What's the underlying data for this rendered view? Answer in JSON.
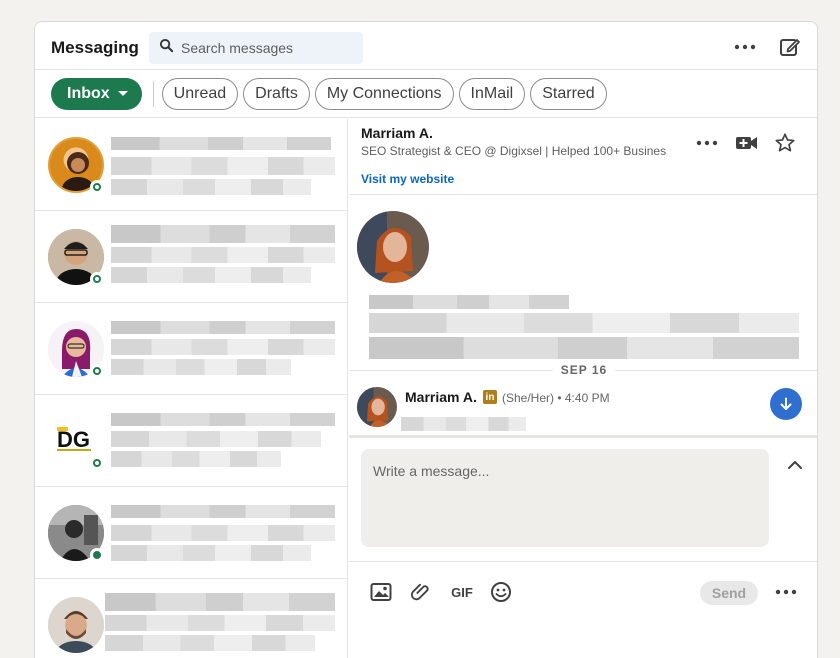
{
  "header": {
    "title": "Messaging",
    "search_placeholder": "Search messages"
  },
  "filters": {
    "inbox_label": "Inbox",
    "pills": [
      "Unread",
      "Drafts",
      "My Connections",
      "InMail",
      "Starred"
    ]
  },
  "thread": {
    "name": "Marriam A.",
    "headline": "SEO Strategist & CEO @ Digixsel | Helped 100+ Busines",
    "website_link": "Visit my website",
    "date_divider": "SEP 16",
    "message": {
      "sender": "Marriam A.",
      "linkedin_badge": "in",
      "meta": "(She/Her) • 4:40 PM"
    },
    "compose_placeholder": "Write a message...",
    "gif_label": "GIF",
    "send_label": "Send"
  },
  "conversations": [
    {
      "avatar": "avatar-orange",
      "online": true
    },
    {
      "avatar": "avatar-man-glasses",
      "online": true
    },
    {
      "avatar": "avatar-woman-glasses",
      "online": true
    },
    {
      "avatar": "avatar-dg-logo",
      "online": true
    },
    {
      "avatar": "avatar-bw-photo",
      "online": true
    },
    {
      "avatar": "avatar-man-beard",
      "online": false
    }
  ],
  "colors": {
    "inbox_green": "#1d7a4e",
    "link_blue": "#0a66c2",
    "scroll_button": "#2f6fd0",
    "premium_badge": "#b07d1a"
  }
}
